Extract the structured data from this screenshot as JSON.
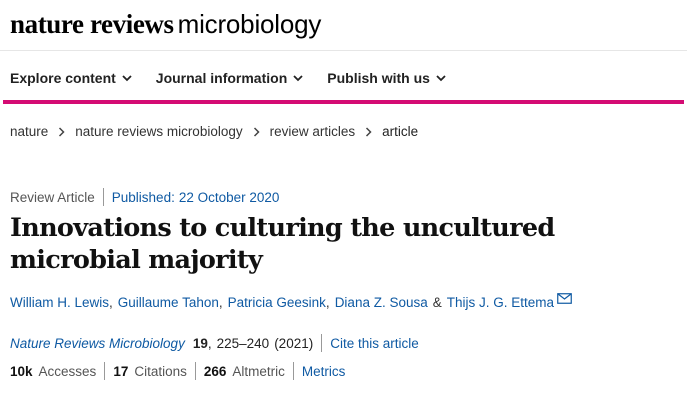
{
  "header": {
    "logo_bold": "nature reviews",
    "logo_light": "microbiology"
  },
  "nav": {
    "items": [
      {
        "label": "Explore content"
      },
      {
        "label": "Journal information"
      },
      {
        "label": "Publish with us"
      }
    ]
  },
  "breadcrumb": [
    "nature",
    "nature reviews microbiology",
    "review articles",
    "article"
  ],
  "article": {
    "type": "Review Article",
    "published_label": "Published:",
    "published_date": "22 October 2020",
    "title": "Innovations to culturing the uncultured microbial majority",
    "authors": [
      "William H. Lewis",
      "Guillaume Tahon",
      "Patricia Geesink",
      "Diana Z. Sousa",
      "Thijs J. G. Ettema"
    ],
    "author_separator": ",",
    "author_and": "&",
    "journal": "Nature Reviews Microbiology",
    "volume": "19",
    "pages": "225–240",
    "year": "(2021)",
    "cite_label": "Cite this article"
  },
  "metrics": {
    "accesses_value": "10k",
    "accesses_label": "Accesses",
    "citations_value": "17",
    "citations_label": "Citations",
    "altmetric_value": "266",
    "altmetric_label": "Altmetric",
    "metrics_link": "Metrics"
  },
  "colors": {
    "accent": "#d40b73",
    "link": "#0f5aa3"
  },
  "icons": [
    "chevron-down-icon",
    "chevron-right-icon",
    "mail-icon"
  ]
}
